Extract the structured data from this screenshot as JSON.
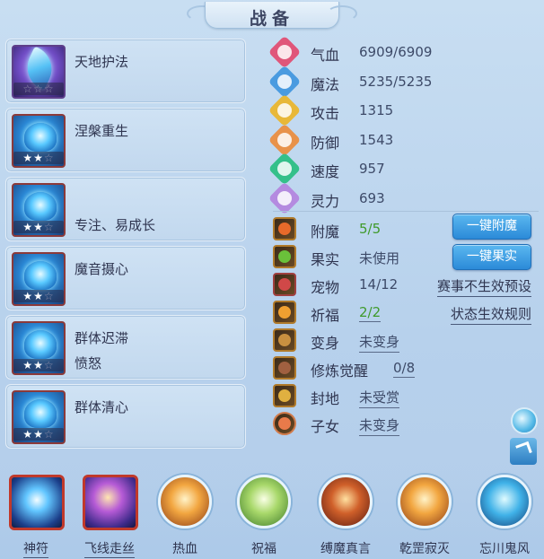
{
  "title": "战备",
  "skills": [
    {
      "name": "天地护法",
      "sub": "",
      "stars": "☆☆☆",
      "stars_on": ""
    },
    {
      "name": "涅槃重生",
      "sub": "",
      "stars": "☆",
      "stars_on": "★★"
    },
    {
      "name": "",
      "sub": "专注、易成长",
      "stars": "☆",
      "stars_on": "★★"
    },
    {
      "name": "魔音摄心",
      "sub": "",
      "stars": "☆",
      "stars_on": "★★"
    },
    {
      "name": "群体迟滞",
      "sub": "愤怒",
      "stars": "☆",
      "stars_on": "★★"
    },
    {
      "name": "群体清心",
      "sub": "",
      "stars": "☆",
      "stars_on": "★★"
    }
  ],
  "stats": [
    {
      "label": "气血",
      "value": "6909/6909",
      "color": "#e0567a"
    },
    {
      "label": "魔法",
      "value": "5235/5235",
      "color": "#4a9be0"
    },
    {
      "label": "攻击",
      "value": "1315",
      "color": "#e8b838"
    },
    {
      "label": "防御",
      "value": "1543",
      "color": "#e8924a"
    },
    {
      "label": "速度",
      "value": "957",
      "color": "#34c08a"
    },
    {
      "label": "灵力",
      "value": "693",
      "color": "#b48ae0"
    }
  ],
  "extras": [
    {
      "label": "附魔",
      "value": "5/5",
      "green": true,
      "icon_color": "#e86a2a"
    },
    {
      "label": "果实",
      "value": "未使用",
      "green": false,
      "icon_color": "#6ac03a"
    },
    {
      "label": "宠物",
      "value": "14/12",
      "green": false,
      "icon_color": "#d04848"
    },
    {
      "label": "祈福",
      "value": "2/2",
      "green": true,
      "icon_color": "#f0a030"
    },
    {
      "label": "变身",
      "value": "未变身",
      "green": false,
      "icon_color": "#c89040"
    },
    {
      "label": "修炼觉醒",
      "value": "0/8",
      "green": false,
      "icon_color": "#a06040"
    },
    {
      "label": "封地",
      "value": "未受赏",
      "green": false,
      "icon_color": "#e0b040"
    },
    {
      "label": "子女",
      "value": "未变身",
      "green": false,
      "icon_color": "#e87a4a"
    }
  ],
  "buttons": {
    "enchant": "一键附魔",
    "fruit": "一键果实"
  },
  "links": {
    "pet_preset": "赛事不生效预设",
    "bless_rule": "状态生效规则"
  },
  "bottom": [
    {
      "label": "神符",
      "style": "sq",
      "underline": true
    },
    {
      "label": "飞线走丝",
      "style": "sq b",
      "underline": true
    },
    {
      "label": "热血",
      "style": "ring",
      "underline": false
    },
    {
      "label": "祝福",
      "style": "ring green",
      "underline": false
    },
    {
      "label": "缚魔真言",
      "style": "ring red",
      "underline": false
    },
    {
      "label": "乾罡寂灭",
      "style": "ring",
      "underline": false
    },
    {
      "label": "忘川鬼风",
      "style": "ring blue",
      "underline": false
    }
  ]
}
